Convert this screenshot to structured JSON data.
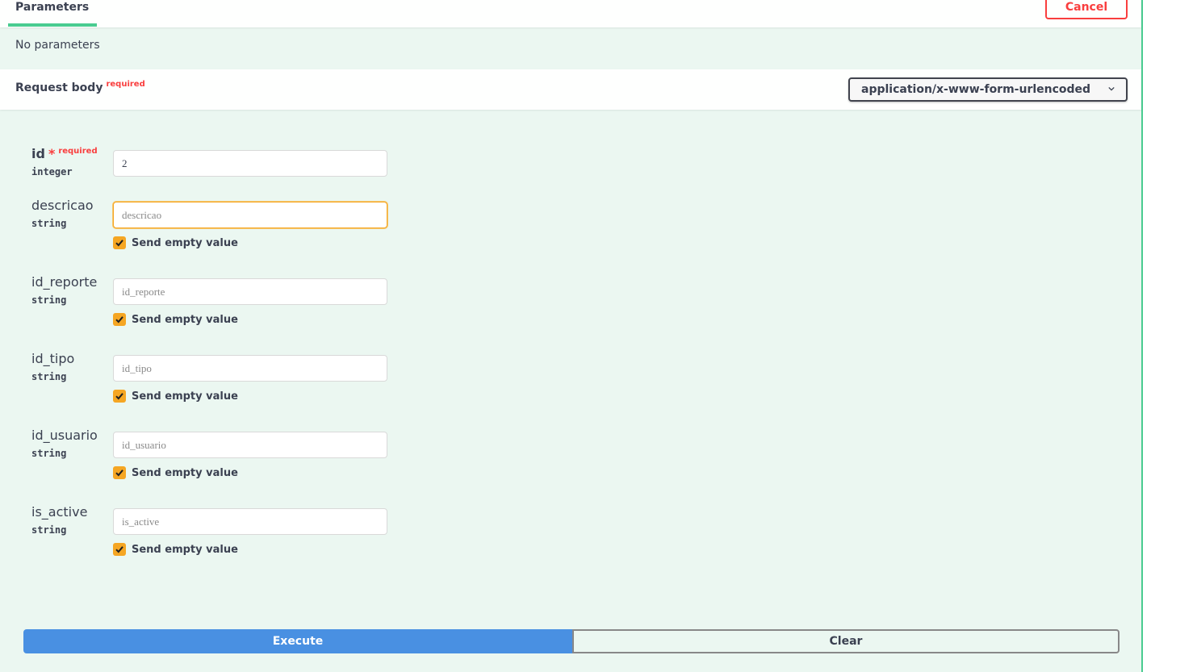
{
  "parameters": {
    "tab_label": "Parameters",
    "cancel_label": "Cancel",
    "empty_message": "No parameters"
  },
  "request_body": {
    "title": "Request body",
    "required_label": "required",
    "content_type": "application/x-www-form-urlencoded"
  },
  "fields": [
    {
      "name": "id",
      "type": "integer",
      "required_marker": "*",
      "required_label": "required",
      "value": "2",
      "placeholder": ""
    },
    {
      "name": "descricao",
      "type": "string",
      "value": "",
      "placeholder": "descricao",
      "send_empty_label": "Send empty value",
      "send_empty_checked": true
    },
    {
      "name": "id_reporte",
      "type": "string",
      "value": "",
      "placeholder": "id_reporte",
      "send_empty_label": "Send empty value",
      "send_empty_checked": true
    },
    {
      "name": "id_tipo",
      "type": "string",
      "value": "",
      "placeholder": "id_tipo",
      "send_empty_label": "Send empty value",
      "send_empty_checked": true
    },
    {
      "name": "id_usuario",
      "type": "string",
      "value": "",
      "placeholder": "id_usuario",
      "send_empty_label": "Send empty value",
      "send_empty_checked": true
    },
    {
      "name": "is_active",
      "type": "string",
      "value": "",
      "placeholder": "is_active",
      "send_empty_label": "Send empty value",
      "send_empty_checked": true
    }
  ],
  "actions": {
    "execute_label": "Execute",
    "clear_label": "Clear"
  },
  "colors": {
    "panel_background": "#ebf7f1",
    "accent_green": "#49cc90",
    "cancel_red": "#f93e3e",
    "checkbox_orange": "#f5a623",
    "execute_blue": "#4990e2"
  }
}
